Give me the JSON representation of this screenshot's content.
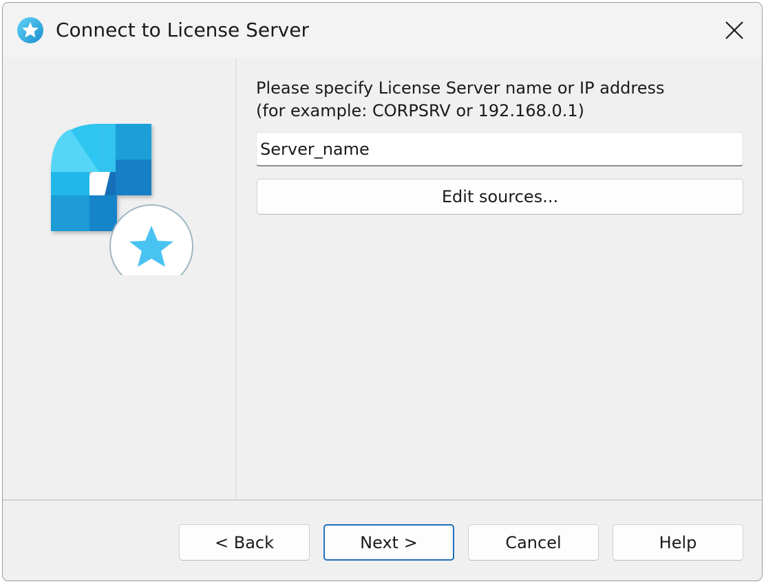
{
  "window": {
    "title": "Connect to License Server",
    "accent_color": "#1f6fba",
    "logo_color": "#1fa3e0"
  },
  "prompt": {
    "line1": "Please specify License Server name or IP address",
    "line2": "(for example: CORPSRV or 192.168.0.1)"
  },
  "server_field": {
    "value": "Server_name"
  },
  "buttons": {
    "edit_sources": "Edit sources...",
    "back": "< Back",
    "next": "Next >",
    "cancel": "Cancel",
    "help": "Help"
  }
}
